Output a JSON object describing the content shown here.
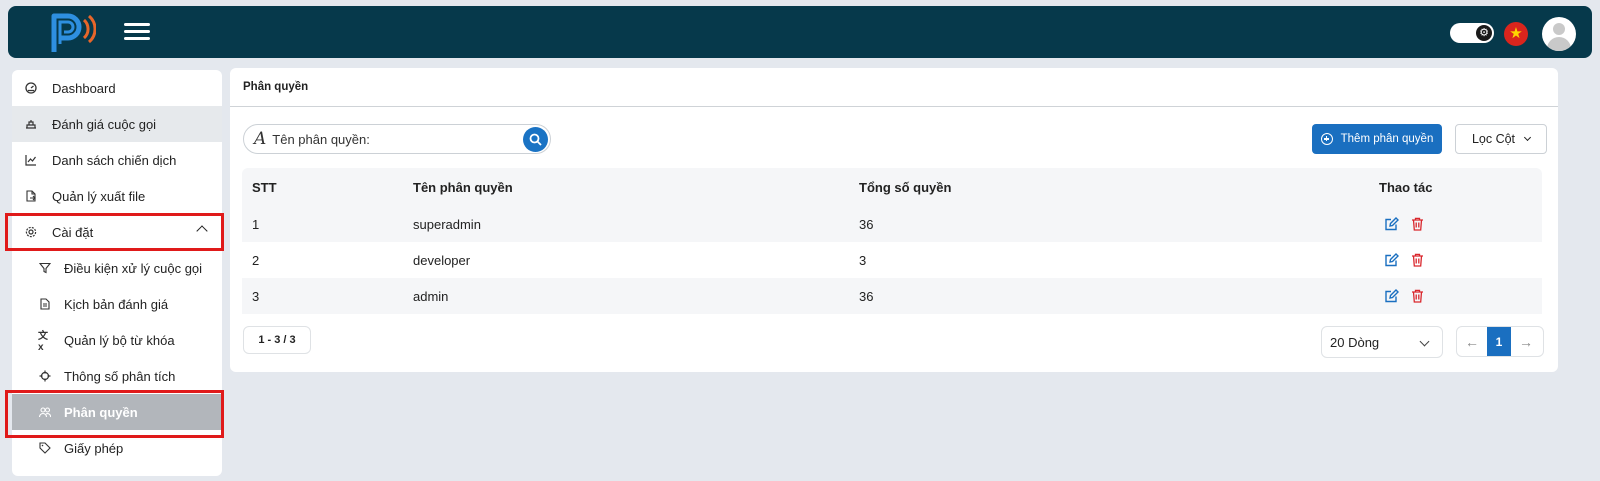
{
  "header": {
    "logo": "p-signal-logo",
    "menu_icon": "hamburger-icon",
    "theme_toggle": "gear-toggle-icon",
    "language_flag": "vietnam-flag-icon",
    "avatar": "user-avatar-icon"
  },
  "sidebar": {
    "items": [
      {
        "label": "Dashboard",
        "icon": "dashboard-icon"
      },
      {
        "label": "Đánh giá cuộc gọi",
        "icon": "call-review-icon"
      },
      {
        "label": "Danh sách chiến dịch",
        "icon": "chart-line-icon"
      },
      {
        "label": "Quản lý xuất file",
        "icon": "file-export-icon"
      },
      {
        "label": "Cài đặt",
        "icon": "settings-icon",
        "expanded": true
      },
      {
        "label": "Điều kiện xử lý cuộc gọi",
        "icon": "filter-icon"
      },
      {
        "label": "Kịch bản đánh giá",
        "icon": "document-icon"
      },
      {
        "label": "Quản lý bộ từ khóa",
        "icon": "translate-icon"
      },
      {
        "label": "Thông số phân tích",
        "icon": "crosshair-icon"
      },
      {
        "label": "Phân quyền",
        "icon": "users-icon",
        "active": true
      },
      {
        "label": "Giấy phép",
        "icon": "tag-icon"
      }
    ]
  },
  "main": {
    "title": "Phân quyền",
    "search": {
      "placeholder": "Tên phân quyền:"
    },
    "add_button": "Thêm phân quyền",
    "filter_button": "Lọc Cột",
    "table": {
      "columns": [
        "STT",
        "Tên phân quyền",
        "Tổng số quyền",
        "Thao tác"
      ],
      "rows": [
        {
          "stt": "1",
          "name": "superadmin",
          "total": "36"
        },
        {
          "stt": "2",
          "name": "developer",
          "total": "3"
        },
        {
          "stt": "3",
          "name": "admin",
          "total": "36"
        }
      ]
    },
    "pagination": {
      "range_start": "1",
      "range_end": "3",
      "total": "3",
      "rows_per_page": "20 Dòng",
      "current_page": "1"
    }
  },
  "colors": {
    "header_bg": "#06394b",
    "primary": "#1a6fc0",
    "highlight_box": "#e01a1a",
    "active_item": "#b2b6bb",
    "delete": "#d9262c"
  }
}
